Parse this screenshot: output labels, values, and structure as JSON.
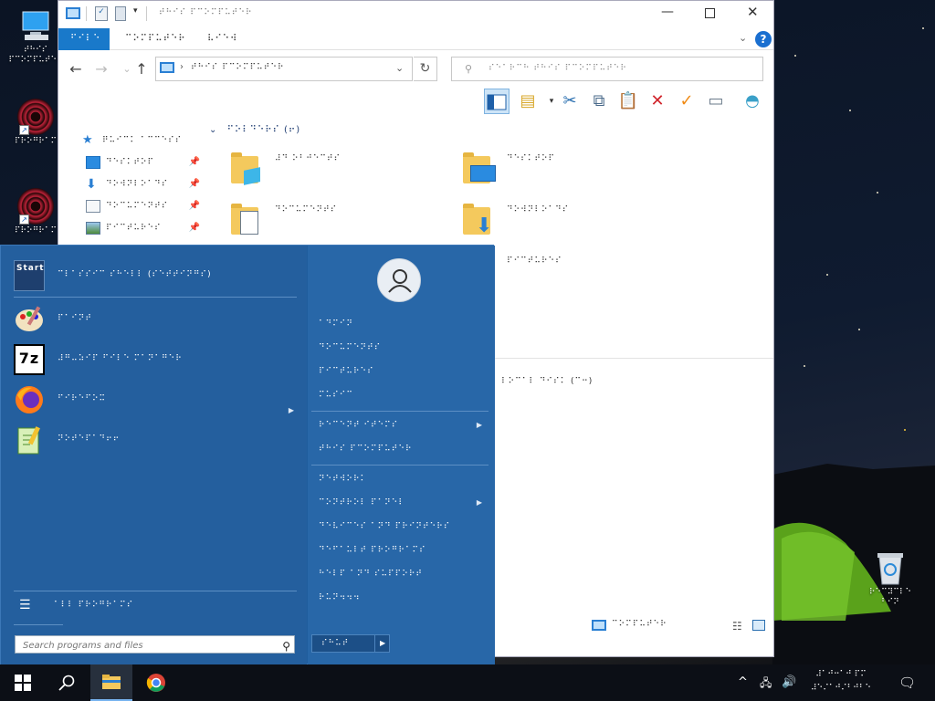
{
  "desktop": {
    "icons": [
      {
        "label": "⠞⠓⠊⠎ ⠏⠉⠕⠍⠏⠥⠞⠑⠗"
      },
      {
        "label": "⠏⠗⠕⠛⠗⠁⠍"
      },
      {
        "label": "⠏⠗⠕⠛⠗⠁⠍"
      },
      {
        "label": "⠗⠑⠉⠽⠉⠇⠑ ⠃⠊⠝"
      }
    ]
  },
  "explorer": {
    "title": "⠞⠓⠊⠎ ⠏⠉⠕⠍⠏⠥⠞⠑⠗",
    "tabs": [
      "⠋⠊⠇⠑",
      "⠉⠕⠍⠏⠥⠞⠑⠗",
      "⠧⠊⠑⠺"
    ],
    "address": "⠞⠓⠊⠎ ⠏⠉⠕⠍⠏⠥⠞⠑⠗",
    "search_placeholder": "⠎⠑⠁⠗⠉⠓ ⠞⠓⠊⠎ ⠏⠉⠕⠍⠏⠥⠞⠑⠗",
    "nav": [
      {
        "label": "⠟⠥⠊⠉⠅ ⠁⠉⠉⠑⠎⠎",
        "icon": "star-icon"
      },
      {
        "label": "⠙⠑⠎⠅⠞⠕⠏",
        "icon": "desktop-icon",
        "pinned": true
      },
      {
        "label": "⠙⠕⠺⠝⠇⠕⠁⠙⠎",
        "icon": "download-icon",
        "pinned": true
      },
      {
        "label": "⠙⠕⠉⠥⠍⠑⠝⠞⠎",
        "icon": "document-icon",
        "pinned": true
      },
      {
        "label": "⠏⠊⠉⠞⠥⠗⠑⠎",
        "icon": "pictures-icon",
        "pinned": true
      }
    ],
    "group_folders": "⠋⠕⠇⠙⠑⠗⠎ (⠖)",
    "folders": [
      {
        "label": "⠼⠙ ⠕⠃⠚⠑⠉⠞⠎",
        "icon": "3d-objects-folder-icon"
      },
      {
        "label": "⠙⠑⠎⠅⠞⠕⠏",
        "icon": "desktop-folder-icon"
      },
      {
        "label": "⠙⠕⠉⠥⠍⠑⠝⠞⠎",
        "icon": "documents-folder-icon"
      },
      {
        "label": "⠙⠕⠺⠝⠇⠕⠁⠙⠎",
        "icon": "downloads-folder-icon"
      },
      {
        "label": "⠏⠊⠉⠞⠥⠗⠑⠎",
        "icon": "pictures-folder-icon"
      }
    ],
    "drive": "⠇⠕⠉⠁⠇ ⠙⠊⠎⠅ (⠉⠒)",
    "status_location": "⠉⠕⠍⠏⠥⠞⠑⠗"
  },
  "startmenu": {
    "programs": [
      {
        "label": "⠉⠇⠁⠎⠎⠊⠉ ⠎⠓⠑⠇⠇ (⠎⠑⠞⠞⠊⠝⠛⠎)",
        "icon": "start-settings-icon"
      },
      {
        "label": "⠏⠁⠊⠝⠞",
        "icon": "paint-icon"
      },
      {
        "label": "⠼⠛⠤⠵⠊⠏ ⠋⠊⠇⠑ ⠍⠁⠝⠁⠛⠑⠗",
        "icon": "7zip-icon"
      },
      {
        "label": "⠋⠊⠗⠑⠋⠕⠭",
        "icon": "firefox-icon",
        "submenu": true
      },
      {
        "label": "⠝⠕⠞⠑⠏⠁⠙⠖⠖",
        "icon": "notepadpp-icon"
      }
    ],
    "all_programs": "⠁⠇⠇ ⠏⠗⠕⠛⠗⠁⠍⠎",
    "search_placeholder": "Search programs and files",
    "places": [
      {
        "label": "⠁⠙⠍⠊⠝"
      },
      {
        "label": "⠙⠕⠉⠥⠍⠑⠝⠞⠎"
      },
      {
        "label": "⠏⠊⠉⠞⠥⠗⠑⠎"
      },
      {
        "label": "⠍⠥⠎⠊⠉"
      },
      {
        "label": "⠗⠑⠉⠑⠝⠞ ⠊⠞⠑⠍⠎",
        "submenu": true
      },
      {
        "label": "⠞⠓⠊⠎ ⠏⠉⠕⠍⠏⠥⠞⠑⠗"
      },
      {
        "label": "⠝⠑⠞⠺⠕⠗⠅"
      },
      {
        "label": "⠉⠕⠝⠞⠗⠕⠇ ⠏⠁⠝⠑⠇",
        "submenu": true
      },
      {
        "label": "⠙⠑⠧⠊⠉⠑⠎ ⠁⠝⠙ ⠏⠗⠊⠝⠞⠑⠗⠎"
      },
      {
        "label": "⠙⠑⠋⠁⠥⠇⠞ ⠏⠗⠕⠛⠗⠁⠍⠎"
      },
      {
        "label": "⠓⠑⠇⠏ ⠁⠝⠙ ⠎⠥⠏⠏⠕⠗⠞"
      },
      {
        "label": "⠗⠥⠝⠲⠲⠲"
      }
    ],
    "shutdown": "⠎⠓⠥⠞"
  },
  "taskbar": {
    "clock": "⠼⠁⠚⠒⠁⠚ ⠏⠍",
    "date": "⠼⠑⠌⠁⠚⠌⠃⠚⠃⠑"
  },
  "colors": {
    "start_menu": "#245f9e",
    "accent": "#1979ca"
  }
}
